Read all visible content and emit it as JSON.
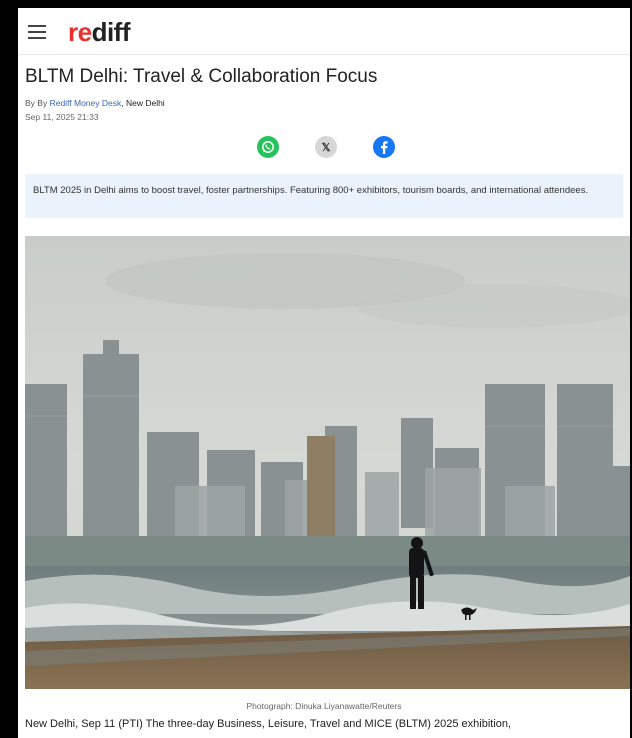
{
  "header": {
    "logo": {
      "re": "re",
      "diff": "diff"
    },
    "menu_icon": "hamburger-icon"
  },
  "article": {
    "headline": "BLTM Delhi: Travel & Collaboration Focus",
    "byline_prefix": "By By",
    "author": "Rediff Money Desk",
    "location": ", New Delhi",
    "date": "Sep 11, 2025 21:33",
    "summary": "BLTM 2025 in Delhi aims to boost travel, foster partnerships. Featuring 800+ exhibitors, tourism boards, and international attendees.",
    "photo_credit": "Photograph: Dinuka Liyanawatte/Reuters",
    "body_first_line": "New Delhi, Sep 11 (PTI) The three-day Business, Leisure, Travel and MICE (BLTM) 2025 exhibition,"
  },
  "share": {
    "whatsapp_icon": "whatsapp-icon",
    "x_label": "𝕏",
    "facebook_icon": "facebook-icon",
    "colors": {
      "whatsapp": "#25c35a",
      "x": "#d7d7d7",
      "facebook": "#1877f2"
    }
  },
  "colors": {
    "brand_red": "#e8322d",
    "link_blue": "#3a67b8",
    "summary_bg": "#eaf2fb"
  }
}
